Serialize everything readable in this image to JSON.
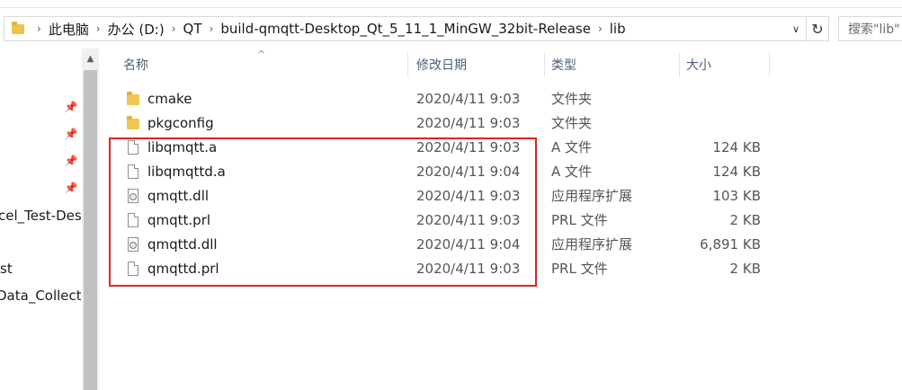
{
  "address_bar": {
    "crumbs": [
      "此电脑",
      "办公 (D:)",
      "QT",
      "build-qmqtt-Desktop_Qt_5_11_1_MinGW_32bit-Release",
      "lib"
    ],
    "dropdown_icon": "chevron-down-icon",
    "refresh_icon": "refresh-icon"
  },
  "search": {
    "placeholder": "搜索\"lib\""
  },
  "nav_pane": {
    "items": [
      "cel_Test-Des",
      "st",
      "Data_Collectio"
    ],
    "pin_icon": "pin-icon"
  },
  "columns": {
    "name": "名称",
    "date": "修改日期",
    "type": "类型",
    "size": "大小"
  },
  "files": [
    {
      "name": "cmake",
      "date": "2020/4/11 9:03",
      "type": "文件夹",
      "size": "",
      "icon": "folder-icon"
    },
    {
      "name": "pkgconfig",
      "date": "2020/4/11 9:03",
      "type": "文件夹",
      "size": "",
      "icon": "folder-icon"
    },
    {
      "name": "libqmqtt.a",
      "date": "2020/4/11 9:03",
      "type": "A 文件",
      "size": "124 KB",
      "icon": "file-icon"
    },
    {
      "name": "libqmqttd.a",
      "date": "2020/4/11 9:04",
      "type": "A 文件",
      "size": "124 KB",
      "icon": "file-icon"
    },
    {
      "name": "qmqtt.dll",
      "date": "2020/4/11 9:03",
      "type": "应用程序扩展",
      "size": "103 KB",
      "icon": "dll-icon"
    },
    {
      "name": "qmqtt.prl",
      "date": "2020/4/11 9:03",
      "type": "PRL 文件",
      "size": "2 KB",
      "icon": "file-icon"
    },
    {
      "name": "qmqttd.dll",
      "date": "2020/4/11 9:04",
      "type": "应用程序扩展",
      "size": "6,891 KB",
      "icon": "dll-icon"
    },
    {
      "name": "qmqttd.prl",
      "date": "2020/4/11 9:03",
      "type": "PRL 文件",
      "size": "2 KB",
      "icon": "file-icon"
    }
  ],
  "highlight_color": "#e02424"
}
